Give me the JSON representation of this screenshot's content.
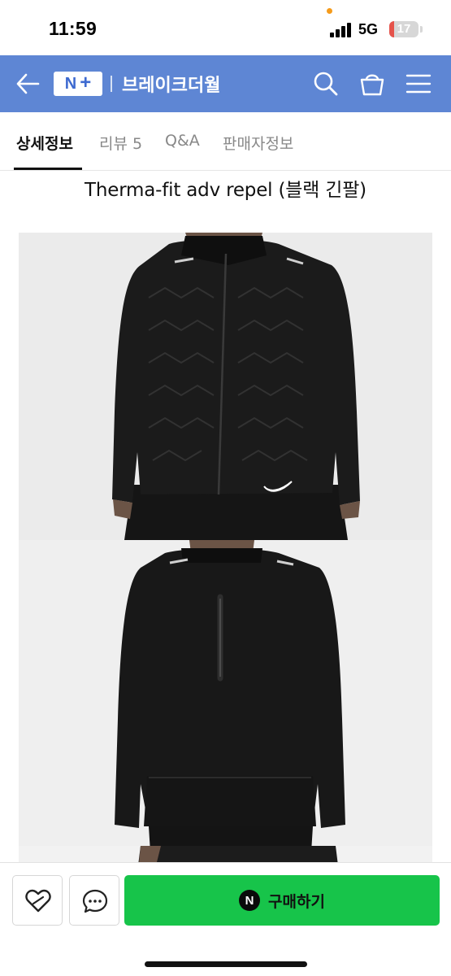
{
  "status_bar": {
    "time": "11:59",
    "network": "5G",
    "battery_level": "17",
    "battery_fraction": 0.17,
    "battery_color": "#e5534b"
  },
  "header": {
    "logo_n": "N",
    "logo_plus": "+",
    "store_name": "브레이크더월",
    "background_color": "#5e86d4",
    "icons": [
      "back-arrow-icon",
      "search-icon",
      "shopping-bag-icon",
      "hamburger-menu-icon"
    ]
  },
  "tabs": [
    {
      "label": "상세정보",
      "active": true
    },
    {
      "label": "리뷰 5",
      "active": false
    },
    {
      "label": "Q&A",
      "active": false
    },
    {
      "label": "판매자정보",
      "active": false
    }
  ],
  "product": {
    "title": "Therma-fit adv repel (블랙 긴팔)"
  },
  "bottom_bar": {
    "pay_badge": "N",
    "buy_label": "구매하기",
    "buy_color": "#17c44a",
    "icons": [
      "heart-wish-icon",
      "chat-bubble-icon"
    ]
  }
}
